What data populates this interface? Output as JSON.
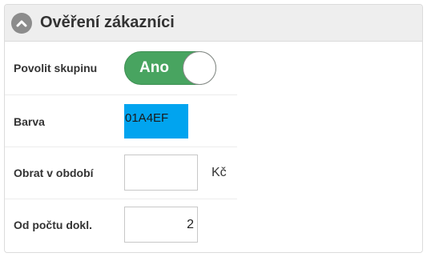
{
  "panel": {
    "title": "Ověření zákazníci",
    "collapse_icon": "chevron-up-icon"
  },
  "fields": {
    "enable_group": {
      "label": "Povolit skupinu",
      "toggle_text": "Ano",
      "checked": true
    },
    "color": {
      "label": "Barva",
      "value": "01A4EF",
      "swatch_color": "#01A4EF"
    },
    "turnover": {
      "label": "Obrat v období",
      "value": "",
      "unit": "Kč"
    },
    "doc_count": {
      "label": "Od počtu dokl.",
      "value": "2"
    }
  },
  "colors": {
    "toggle_on": "#48A460",
    "header_bg": "#EEEEEE",
    "icon_bg": "#8C8C8C"
  }
}
